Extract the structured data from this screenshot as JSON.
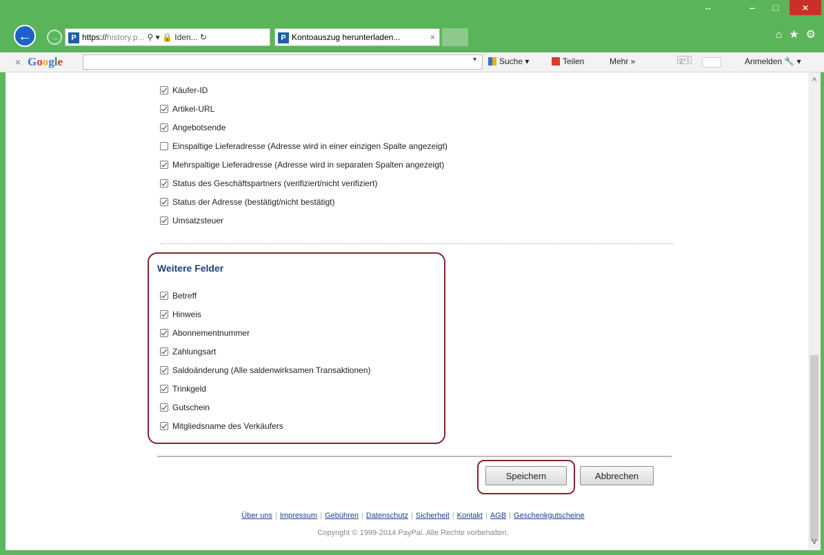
{
  "window": {
    "restore_glyph": "↔",
    "minimize_glyph": "–",
    "maximize_glyph": "□",
    "close_glyph": "×"
  },
  "nav": {
    "back_glyph": "←",
    "forward_glyph": "→",
    "address_scheme": "https://",
    "address_host": "history.p...",
    "address_tools": "⚲ ▾ 🔒 Iden... ↻",
    "tab_title": "Kontoauszug herunterladen...",
    "tab_close": "×",
    "home_glyph": "⌂",
    "star_glyph": "★",
    "gear_glyph": "⚙"
  },
  "google_toolbar": {
    "close": "×",
    "logo": [
      "G",
      "o",
      "o",
      "g",
      "l",
      "e"
    ],
    "caret": "▾",
    "suche": "Suche ▾",
    "teilen": "Teilen",
    "mehr": "Mehr »",
    "g1": "g+1",
    "anmelden": "Anmelden 🔧 ▾"
  },
  "fields_top": [
    {
      "label": "Käufer-ID",
      "checked": true
    },
    {
      "label": "Artikel-URL",
      "checked": true
    },
    {
      "label": "Angebotsende",
      "checked": true
    },
    {
      "label": "Einspaltige Lieferadresse (Adresse wird in einer einzigen Spalte angezeigt)",
      "checked": false
    },
    {
      "label": "Mehrspaltige Lieferadresse (Adresse wird in separaten Spalten angezeigt)",
      "checked": true
    },
    {
      "label": "Status des Geschäftspartners (verifiziert/nicht verifiziert)",
      "checked": true
    },
    {
      "label": "Status der Adresse (bestätigt/nicht bestätigt)",
      "checked": true
    },
    {
      "label": "Umsatzsteuer",
      "checked": true
    }
  ],
  "weitere": {
    "title": "Weitere Felder",
    "fields": [
      {
        "label": "Betreff",
        "checked": true
      },
      {
        "label": "Hinweis",
        "checked": true
      },
      {
        "label": "Abonnementnummer",
        "checked": true
      },
      {
        "label": "Zahlungsart",
        "checked": true
      },
      {
        "label": "Saldoänderung (Alle saldenwirksamen Transaktionen)",
        "checked": true
      },
      {
        "label": "Trinkgeld",
        "checked": true
      },
      {
        "label": "Gutschein",
        "checked": true
      },
      {
        "label": "Mitgliedsname des Verkäufers",
        "checked": true
      }
    ]
  },
  "buttons": {
    "save": "Speichern",
    "cancel": "Abbrechen"
  },
  "footer": {
    "links": [
      "Über uns",
      "Impressum",
      "Gebühren",
      "Datenschutz",
      "Sicherheit",
      "Kontakt",
      "AGB",
      "Geschenkgutscheine"
    ],
    "copyright": "Copyright © 1999-2014 PayPal. Alle Rechte vorbehalten."
  },
  "scroll": {
    "up_glyph": "^",
    "down_glyph": "v"
  },
  "colors": {
    "window_chrome": "#5ab55a",
    "highlight": "#8a1f2e",
    "section_title": "#1c3f7a",
    "link": "#1b3f8f"
  }
}
